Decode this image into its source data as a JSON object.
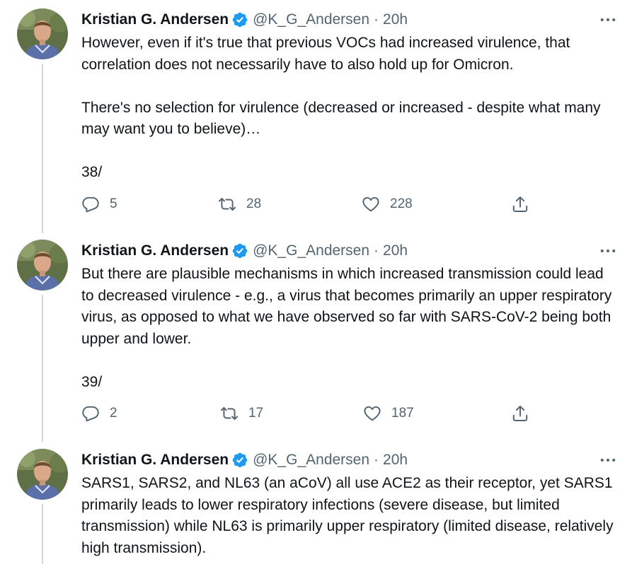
{
  "colors": {
    "text": "#0f1419",
    "secondary": "#536471",
    "verified": "#1d9bf0",
    "thread_line": "#cfd9de"
  },
  "icons": {
    "reply": "reply-icon",
    "retweet": "retweet-icon",
    "like": "heart-icon",
    "share": "share-icon",
    "more": "more-icon",
    "verified": "verified-badge-icon"
  },
  "tweets": [
    {
      "author": "Kristian G. Andersen",
      "handle": "@K_G_Andersen",
      "separator": "·",
      "time": "20h",
      "paragraphs": [
        "However, even if it's true that previous VOCs had increased virulence, that correlation does not necessarily have to also hold up for Omicron.",
        "There's no selection for virulence (decreased or increased - despite what many may want you to believe)…",
        "38/"
      ],
      "replies": "5",
      "retweets": "28",
      "likes": "228"
    },
    {
      "author": "Kristian G. Andersen",
      "handle": "@K_G_Andersen",
      "separator": "·",
      "time": "20h",
      "paragraphs": [
        "But there are plausible mechanisms in which increased transmission could lead to decreased virulence - e.g., a virus that becomes primarily an upper respiratory virus, as opposed to what we have observed so far with SARS-CoV-2 being both upper and lower.",
        "39/"
      ],
      "replies": "2",
      "retweets": "17",
      "likes": "187"
    },
    {
      "author": "Kristian G. Andersen",
      "handle": "@K_G_Andersen",
      "separator": "·",
      "time": "20h",
      "paragraphs": [
        "SARS1, SARS2, and NL63 (an aCoV) all use ACE2 as their receptor, yet SARS1 primarily leads to lower respiratory infections (severe disease, but limited transmission) while NL63 is primarily upper respiratory (limited disease, relatively high transmission)."
      ]
    }
  ]
}
